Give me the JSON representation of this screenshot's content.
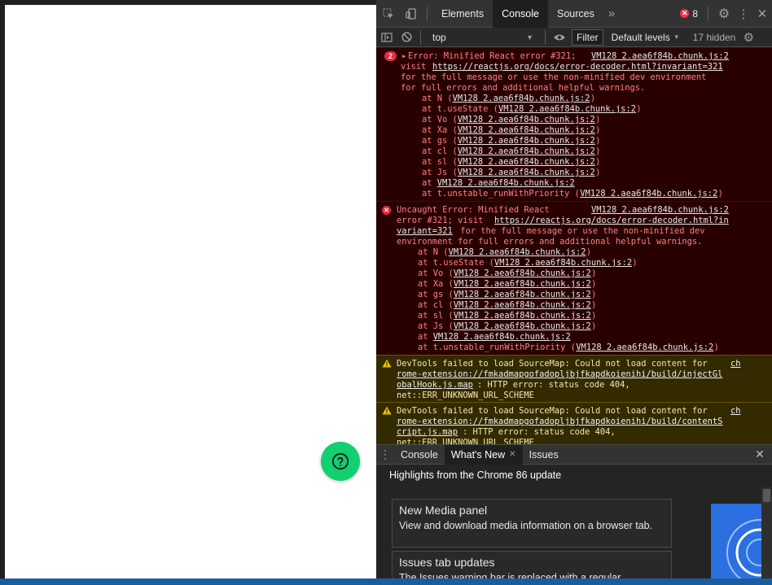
{
  "page": {
    "help_icon": "question-circle-icon",
    "help_color": "#10d070"
  },
  "devtools": {
    "tabs": [
      "Elements",
      "Console",
      "Sources"
    ],
    "more_tabs": "»",
    "error_count": "8",
    "context": "top",
    "filter_label": "Filter",
    "levels_label": "Default levels",
    "hidden_count": "17 hidden"
  },
  "console": {
    "error1": {
      "repeat": "2",
      "text": "Error: Minified React error #321;",
      "source": "VM128 2.aea6f84b.chunk.js:2",
      "visit": "visit ",
      "url": "https://reactjs.org/docs/error-decoder.html?invariant=321",
      "line3": "for the full message or use the non-minified dev environment",
      "line4": "for full errors and additional helpful warnings.",
      "stack": [
        {
          "fn": "at N (",
          "src": "VM128 2.aea6f84b.chunk.js:2",
          "end": ")"
        },
        {
          "fn": "at t.useState (",
          "src": "VM128 2.aea6f84b.chunk.js:2",
          "end": ")"
        },
        {
          "fn": "at Vo (",
          "src": "VM128 2.aea6f84b.chunk.js:2",
          "end": ")"
        },
        {
          "fn": "at Xa (",
          "src": "VM128 2.aea6f84b.chunk.js:2",
          "end": ")"
        },
        {
          "fn": "at gs (",
          "src": "VM128 2.aea6f84b.chunk.js:2",
          "end": ")"
        },
        {
          "fn": "at cl (",
          "src": "VM128 2.aea6f84b.chunk.js:2",
          "end": ")"
        },
        {
          "fn": "at sl (",
          "src": "VM128 2.aea6f84b.chunk.js:2",
          "end": ")"
        },
        {
          "fn": "at Js (",
          "src": "VM128 2.aea6f84b.chunk.js:2",
          "end": ")"
        },
        {
          "fn": "at ",
          "src": "VM128 2.aea6f84b.chunk.js:2",
          "end": ""
        },
        {
          "fn": "at t.unstable_runWithPriority (",
          "src": "VM128 2.aea6f84b.chunk.js:2",
          "end": ")"
        }
      ]
    },
    "error2": {
      "text": "Uncaught Error: Minified React",
      "source": "VM128 2.aea6f84b.chunk.js:2",
      "line2a": "error #321; visit ",
      "url_a": "https://reactjs.org/docs/error-decoder.html?in",
      "url_b": "variant=321",
      "line3b": " for the full message or use the non-minified dev",
      "line4": "environment for full errors and additional helpful warnings.",
      "stack": [
        {
          "fn": "at N (",
          "src": "VM128 2.aea6f84b.chunk.js:2",
          "end": ")"
        },
        {
          "fn": "at t.useState (",
          "src": "VM128 2.aea6f84b.chunk.js:2",
          "end": ")"
        },
        {
          "fn": "at Vo (",
          "src": "VM128 2.aea6f84b.chunk.js:2",
          "end": ")"
        },
        {
          "fn": "at Xa (",
          "src": "VM128 2.aea6f84b.chunk.js:2",
          "end": ")"
        },
        {
          "fn": "at gs (",
          "src": "VM128 2.aea6f84b.chunk.js:2",
          "end": ")"
        },
        {
          "fn": "at cl (",
          "src": "VM128 2.aea6f84b.chunk.js:2",
          "end": ")"
        },
        {
          "fn": "at sl (",
          "src": "VM128 2.aea6f84b.chunk.js:2",
          "end": ")"
        },
        {
          "fn": "at Js (",
          "src": "VM128 2.aea6f84b.chunk.js:2",
          "end": ")"
        },
        {
          "fn": "at ",
          "src": "VM128 2.aea6f84b.chunk.js:2",
          "end": ""
        },
        {
          "fn": "at t.unstable_runWithPriority (",
          "src": "VM128 2.aea6f84b.chunk.js:2",
          "end": ")"
        }
      ]
    },
    "warn1": {
      "a": "DevTools failed to load SourceMap: Could not load content for ",
      "link1": "ch",
      "link2": "rome-extension://fmkadmapgofadopljbjfkapdkoienihi/build/injectGl",
      "link3": "obalHook.js.map",
      "after": ": HTTP error: status code 404,",
      "last": "net::ERR_UNKNOWN_URL_SCHEME"
    },
    "warn2": {
      "a": "DevTools failed to load SourceMap: Could not load content for ",
      "link1": "ch",
      "link2": "rome-extension://fmkadmapgofadopljbjfkapdkoienihi/build/contentS",
      "link3": "cript.js.map",
      "after": ": HTTP error: status code 404,",
      "last": "net::ERR_UNKNOWN_URL_SCHEME"
    }
  },
  "drawer": {
    "tabs": [
      "Console",
      "What's New",
      "Issues"
    ],
    "highlights": "Highlights from the Chrome 86 update",
    "cards": [
      {
        "title": "New Media panel",
        "desc": "View and download media information on a browser tab."
      },
      {
        "title": "Issues tab updates",
        "desc": "The Issues warning bar is replaced with a regular"
      }
    ]
  }
}
